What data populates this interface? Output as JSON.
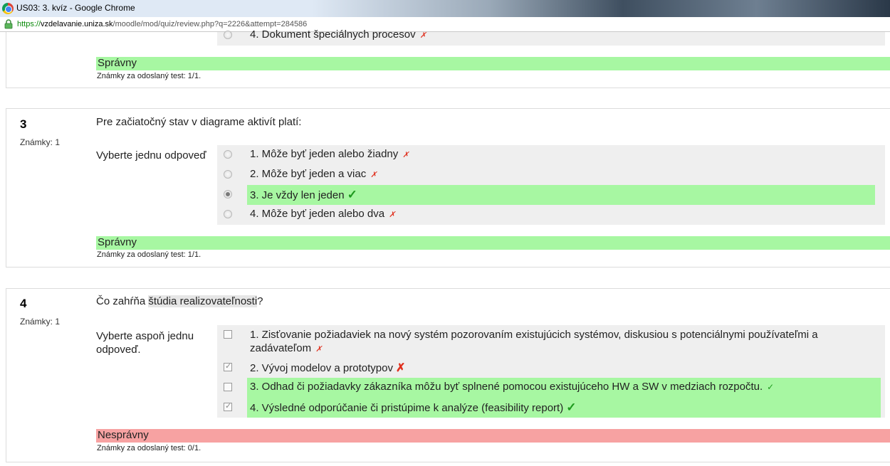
{
  "window": {
    "title": "US03: 3. kvíz - Google Chrome"
  },
  "address": {
    "scheme": "https://",
    "host": "vzdelavanie.uniza.sk",
    "path": "/moodle/mod/quiz/review.php?q=2226&attempt=284586"
  },
  "q2": {
    "last_answer": "4. Dokument špeciálnych procesov",
    "state": "Správny",
    "mark": "Známky za odoslaný test: 1/1."
  },
  "q3": {
    "number": "3",
    "grade": "Známky: 1",
    "text": "Pre začiatočný stav v diagrame aktivít platí:",
    "prompt": "Vyberte jednu odpoveď",
    "answers": [
      {
        "label": "1. Môže byť jeden alebo žiadny",
        "selected": false,
        "result": "wrong"
      },
      {
        "label": "2. Môže byť jeden a viac",
        "selected": false,
        "result": "wrong"
      },
      {
        "label": "3. Je vždy len jeden",
        "selected": true,
        "result": "correct"
      },
      {
        "label": "4. Môže byť jeden alebo dva",
        "selected": false,
        "result": "wrong"
      }
    ],
    "state": "Správny",
    "mark": "Známky za odoslaný test: 1/1."
  },
  "q4": {
    "number": "4",
    "grade": "Známky: 1",
    "text_before": "Čo zahŕňa ",
    "text_highlight": "štúdia realizovateľnosti",
    "text_after": "?",
    "prompt_line1": "Vyberte aspoň jednu",
    "prompt_line2": "odpoveď.",
    "answers": [
      {
        "line1": "1. Zisťovanie požiadaviek na nový systém pozorovaním existujúcich systémov, diskusiou s potenciálnymi používateľmi a",
        "line2": "zadávateľom",
        "selected": false,
        "result": "wrong"
      },
      {
        "label": "2. Vývoj modelov a prototypov",
        "selected": true,
        "result": "wrong"
      },
      {
        "label": "3. Odhad či požiadavky zákazníka môžu byť splnené pomocou existujúceho HW a SW v medziach rozpočtu.",
        "selected": false,
        "result": "correct"
      },
      {
        "label": "4. Výsledné odporúčanie či pristúpime k analýze (feasibility report)",
        "selected": true,
        "result": "correct"
      }
    ],
    "state": "Nesprávny",
    "mark": "Známky za odoslaný test: 0/1."
  },
  "icons": {
    "wrong": "✗",
    "correct": "✓"
  }
}
